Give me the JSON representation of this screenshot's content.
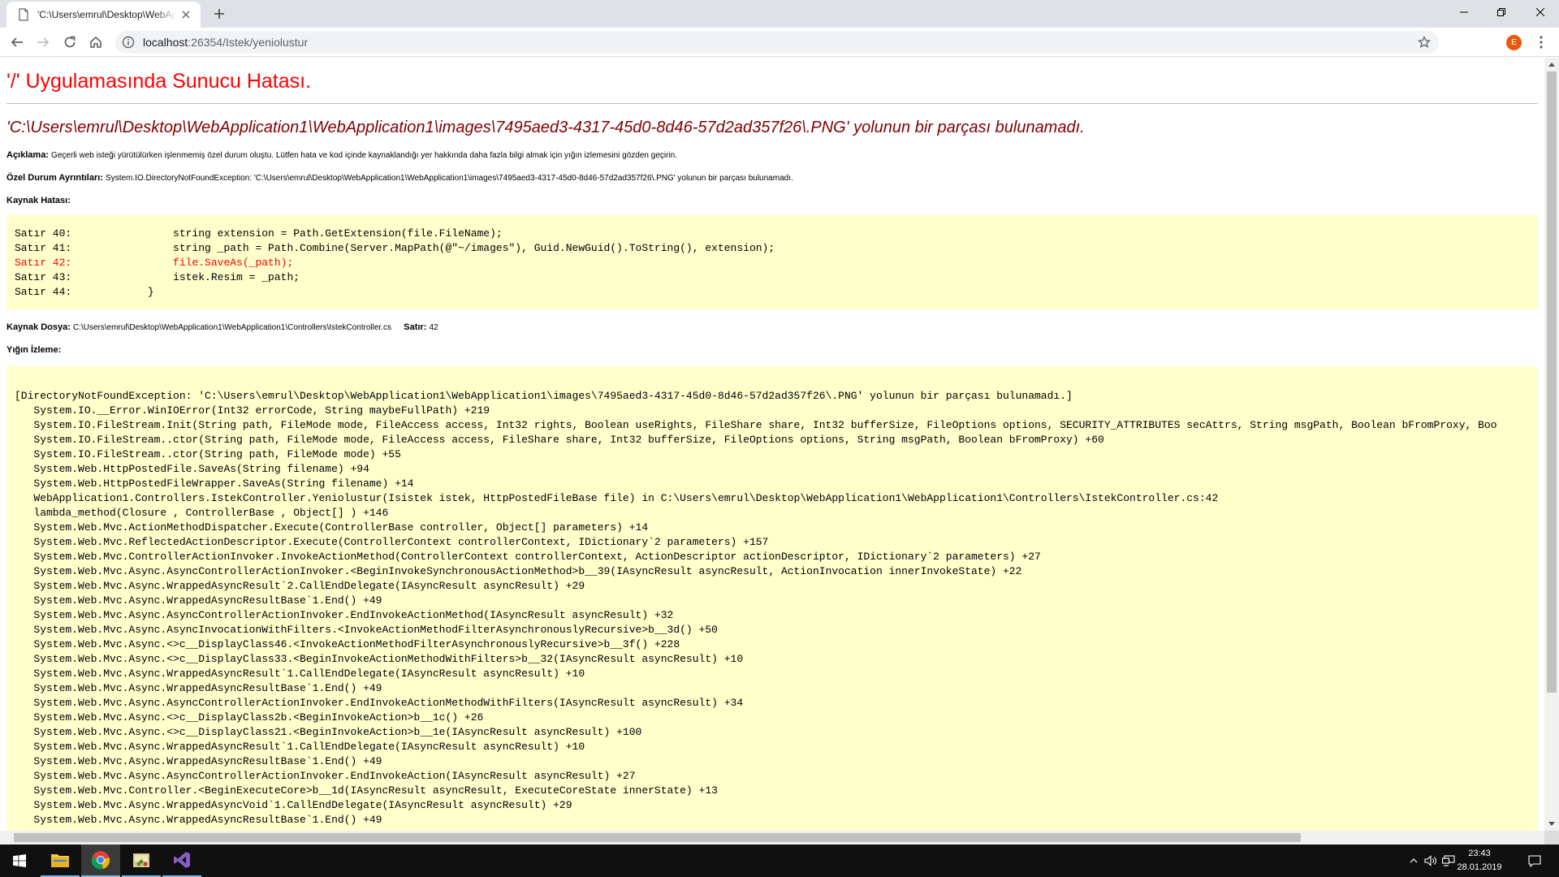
{
  "browser": {
    "tab_title": "'C:\\Users\\emrul\\Desktop\\WebAp",
    "url_host": "localhost",
    "url_rest": ":26354/Istek/yeniolustur",
    "profile_initial": "E",
    "accent": "#e8590c"
  },
  "page": {
    "title": "'/' Uygulamasında Sunucu Hatası.",
    "message": "'C:\\Users\\emrul\\Desktop\\WebApplication1\\WebApplication1\\images\\7495aed3-4317-45d0-8d46-57d2ad357f26\\.PNG' yolunun bir parçası bulunamadı.",
    "description_label": "Açıklama:",
    "description_text": "Geçerli web isteği yürütülürken işlenmemiş özel durum oluştu. Lütfen hata ve kod içinde kaynaklandığı yer hakkında daha fazla bilgi almak için yığın izlemesini gözden geçirin.",
    "exception_label": "Özel Durum Ayrıntıları:",
    "exception_text": "System.IO.DirectoryNotFoundException: 'C:\\Users\\emrul\\Desktop\\WebApplication1\\WebApplication1\\images\\7495aed3-4317-45d0-8d46-57d2ad357f26\\.PNG' yolunun bir parçası bulunamadı.",
    "source_error_label": "Kaynak Hatası:",
    "source_lines": [
      {
        "text": "Satır 40:                string extension = Path.GetExtension(file.FileName);",
        "error": false
      },
      {
        "text": "Satır 41:                string _path = Path.Combine(Server.MapPath(@\"~/images\"), Guid.NewGuid().ToString(), extension);",
        "error": false
      },
      {
        "text": "Satır 42:                file.SaveAs(_path);",
        "error": true
      },
      {
        "text": "Satır 43:                istek.Resim = _path;",
        "error": false
      },
      {
        "text": "Satır 44:            }",
        "error": false
      }
    ],
    "source_file_label": "Kaynak Dosya:",
    "source_file_value": "C:\\Users\\emrul\\Desktop\\WebApplication1\\WebApplication1\\Controllers\\IstekController.cs",
    "source_line_label": "Satır:",
    "source_line_value": "42",
    "stack_label": "Yığın İzleme:",
    "stack_lines": [
      "[DirectoryNotFoundException: 'C:\\Users\\emrul\\Desktop\\WebApplication1\\WebApplication1\\images\\7495aed3-4317-45d0-8d46-57d2ad357f26\\.PNG' yolunun bir parçası bulunamadı.]",
      "   System.IO.__Error.WinIOError(Int32 errorCode, String maybeFullPath) +219",
      "   System.IO.FileStream.Init(String path, FileMode mode, FileAccess access, Int32 rights, Boolean useRights, FileShare share, Int32 bufferSize, FileOptions options, SECURITY_ATTRIBUTES secAttrs, String msgPath, Boolean bFromProxy, Boo",
      "   System.IO.FileStream..ctor(String path, FileMode mode, FileAccess access, FileShare share, Int32 bufferSize, FileOptions options, String msgPath, Boolean bFromProxy) +60",
      "   System.IO.FileStream..ctor(String path, FileMode mode) +55",
      "   System.Web.HttpPostedFile.SaveAs(String filename) +94",
      "   System.Web.HttpPostedFileWrapper.SaveAs(String filename) +14",
      "   WebApplication1.Controllers.IstekController.Yeniolustur(Isistek istek, HttpPostedFileBase file) in C:\\Users\\emrul\\Desktop\\WebApplication1\\WebApplication1\\Controllers\\IstekController.cs:42",
      "   lambda_method(Closure , ControllerBase , Object[] ) +146",
      "   System.Web.Mvc.ActionMethodDispatcher.Execute(ControllerBase controller, Object[] parameters) +14",
      "   System.Web.Mvc.ReflectedActionDescriptor.Execute(ControllerContext controllerContext, IDictionary`2 parameters) +157",
      "   System.Web.Mvc.ControllerActionInvoker.InvokeActionMethod(ControllerContext controllerContext, ActionDescriptor actionDescriptor, IDictionary`2 parameters) +27",
      "   System.Web.Mvc.Async.AsyncControllerActionInvoker.<BeginInvokeSynchronousActionMethod>b__39(IAsyncResult asyncResult, ActionInvocation innerInvokeState) +22",
      "   System.Web.Mvc.Async.WrappedAsyncResult`2.CallEndDelegate(IAsyncResult asyncResult) +29",
      "   System.Web.Mvc.Async.WrappedAsyncResultBase`1.End() +49",
      "   System.Web.Mvc.Async.AsyncControllerActionInvoker.EndInvokeActionMethod(IAsyncResult asyncResult) +32",
      "   System.Web.Mvc.Async.AsyncInvocationWithFilters.<InvokeActionMethodFilterAsynchronouslyRecursive>b__3d() +50",
      "   System.Web.Mvc.Async.<>c__DisplayClass46.<InvokeActionMethodFilterAsynchronouslyRecursive>b__3f() +228",
      "   System.Web.Mvc.Async.<>c__DisplayClass33.<BeginInvokeActionMethodWithFilters>b__32(IAsyncResult asyncResult) +10",
      "   System.Web.Mvc.Async.WrappedAsyncResult`1.CallEndDelegate(IAsyncResult asyncResult) +10",
      "   System.Web.Mvc.Async.WrappedAsyncResultBase`1.End() +49",
      "   System.Web.Mvc.Async.AsyncControllerActionInvoker.EndInvokeActionMethodWithFilters(IAsyncResult asyncResult) +34",
      "   System.Web.Mvc.Async.<>c__DisplayClass2b.<BeginInvokeAction>b__1c() +26",
      "   System.Web.Mvc.Async.<>c__DisplayClass21.<BeginInvokeAction>b__1e(IAsyncResult asyncResult) +100",
      "   System.Web.Mvc.Async.WrappedAsyncResult`1.CallEndDelegate(IAsyncResult asyncResult) +10",
      "   System.Web.Mvc.Async.WrappedAsyncResultBase`1.End() +49",
      "   System.Web.Mvc.Async.AsyncControllerActionInvoker.EndInvokeAction(IAsyncResult asyncResult) +27",
      "   System.Web.Mvc.Controller.<BeginExecuteCore>b__1d(IAsyncResult asyncResult, ExecuteCoreState innerState) +13",
      "   System.Web.Mvc.Async.WrappedAsyncVoid`1.CallEndDelegate(IAsyncResult asyncResult) +29",
      "   System.Web.Mvc.Async.WrappedAsyncResultBase`1.End() +49"
    ],
    "colors": {
      "title": "#ff0000",
      "message": "#800000",
      "code_background": "#ffffcc",
      "error_line": "#ff0000"
    }
  },
  "taskbar": {
    "items": [
      "windows-start",
      "file-explorer",
      "chrome",
      "paint-tool",
      "visual-studio"
    ],
    "time": "23:43",
    "date": "28.01.2019"
  }
}
